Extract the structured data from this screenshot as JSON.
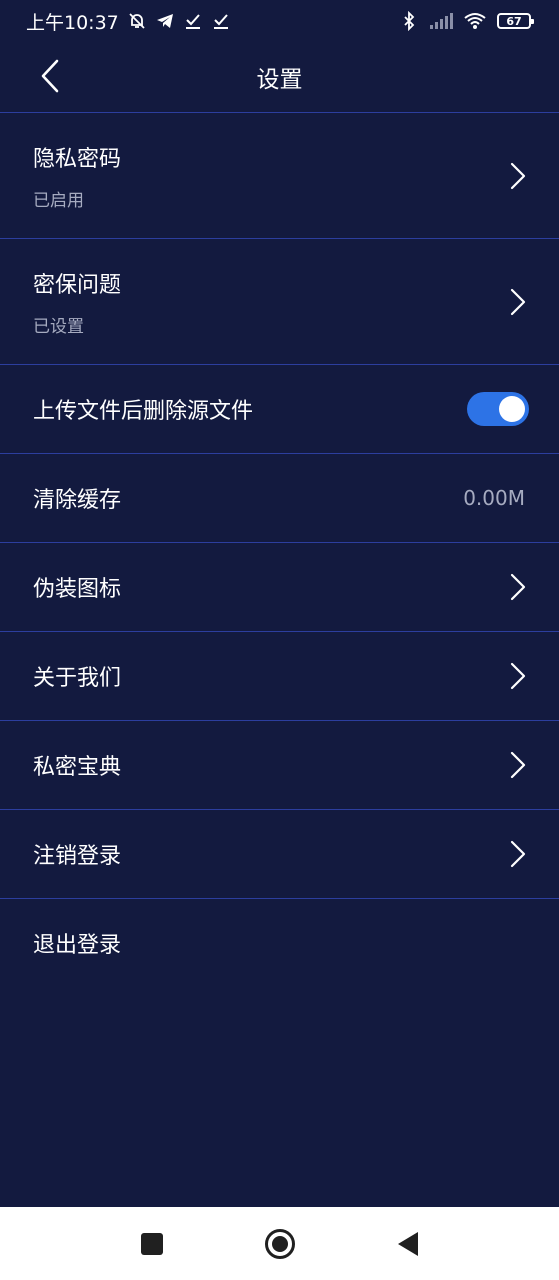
{
  "status_bar": {
    "time": "上午10:37",
    "left_icons": [
      "muted-alarm-icon",
      "telegram-icon",
      "check-icon",
      "check-icon"
    ],
    "right_icons": [
      "bluetooth-icon",
      "signal-icon",
      "wifi-icon"
    ],
    "battery": "67"
  },
  "header": {
    "title": "设置",
    "back_icon": "chevron-left-icon"
  },
  "settings": {
    "privacy_password": {
      "title": "隐私密码",
      "subtitle": "已启用"
    },
    "security_question": {
      "title": "密保问题",
      "subtitle": "已设置"
    },
    "delete_after_upload": {
      "title": "上传文件后删除源文件",
      "enabled": true
    },
    "clear_cache": {
      "title": "清除缓存",
      "value": "0.00M"
    },
    "disguise_icon": {
      "title": "伪装图标"
    },
    "about_us": {
      "title": "关于我们"
    },
    "privacy_guide": {
      "title": "私密宝典"
    },
    "cancel_account": {
      "title": "注销登录"
    },
    "logout": {
      "title": "退出登录"
    }
  },
  "colors": {
    "background": "#131a3f",
    "divider": "#2c3e9e",
    "toggle_on": "#2d73e6",
    "secondary_text": "#a6abc0"
  },
  "nav_bar": {
    "buttons": [
      "recents-square-icon",
      "home-circle-icon",
      "back-triangle-icon"
    ]
  }
}
